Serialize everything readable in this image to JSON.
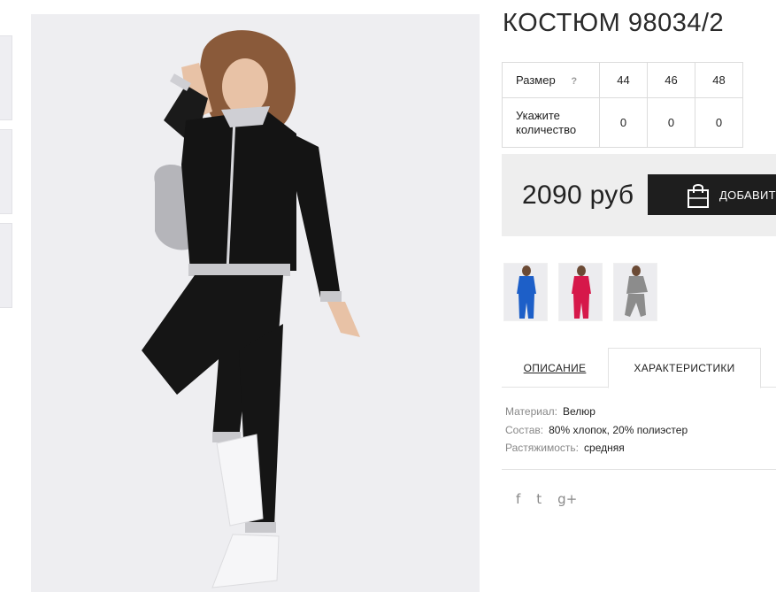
{
  "product": {
    "title": "КОСТЮМ 98034/2"
  },
  "size_table": {
    "size_label": "Размер",
    "help": "?",
    "qty_label_line1": "Укажите",
    "qty_label_line2": "количество",
    "sizes": [
      "44",
      "46",
      "48"
    ],
    "quantities": [
      "0",
      "0",
      "0"
    ]
  },
  "purchase": {
    "price": "2090 руб",
    "add_label": "ДОБАВИТЬ"
  },
  "tabs": {
    "description": "ОПИСАНИЕ",
    "characteristics": "ХАРАКТЕРИСТИКИ"
  },
  "specs": [
    {
      "key": "Материал:",
      "value": "Велюр"
    },
    {
      "key": "Состав:",
      "value": "80% хлопок, 20% полиэстер"
    },
    {
      "key": "Растяжимость:",
      "value": "средняя"
    }
  ],
  "social": {
    "facebook": "f",
    "twitter": "t",
    "googleplus": "g+"
  },
  "colors": {
    "accent": "#1e1e1e",
    "variant_blue": "#1d5fc8",
    "variant_red": "#d6184a",
    "variant_grey": "#8c8c8c"
  }
}
